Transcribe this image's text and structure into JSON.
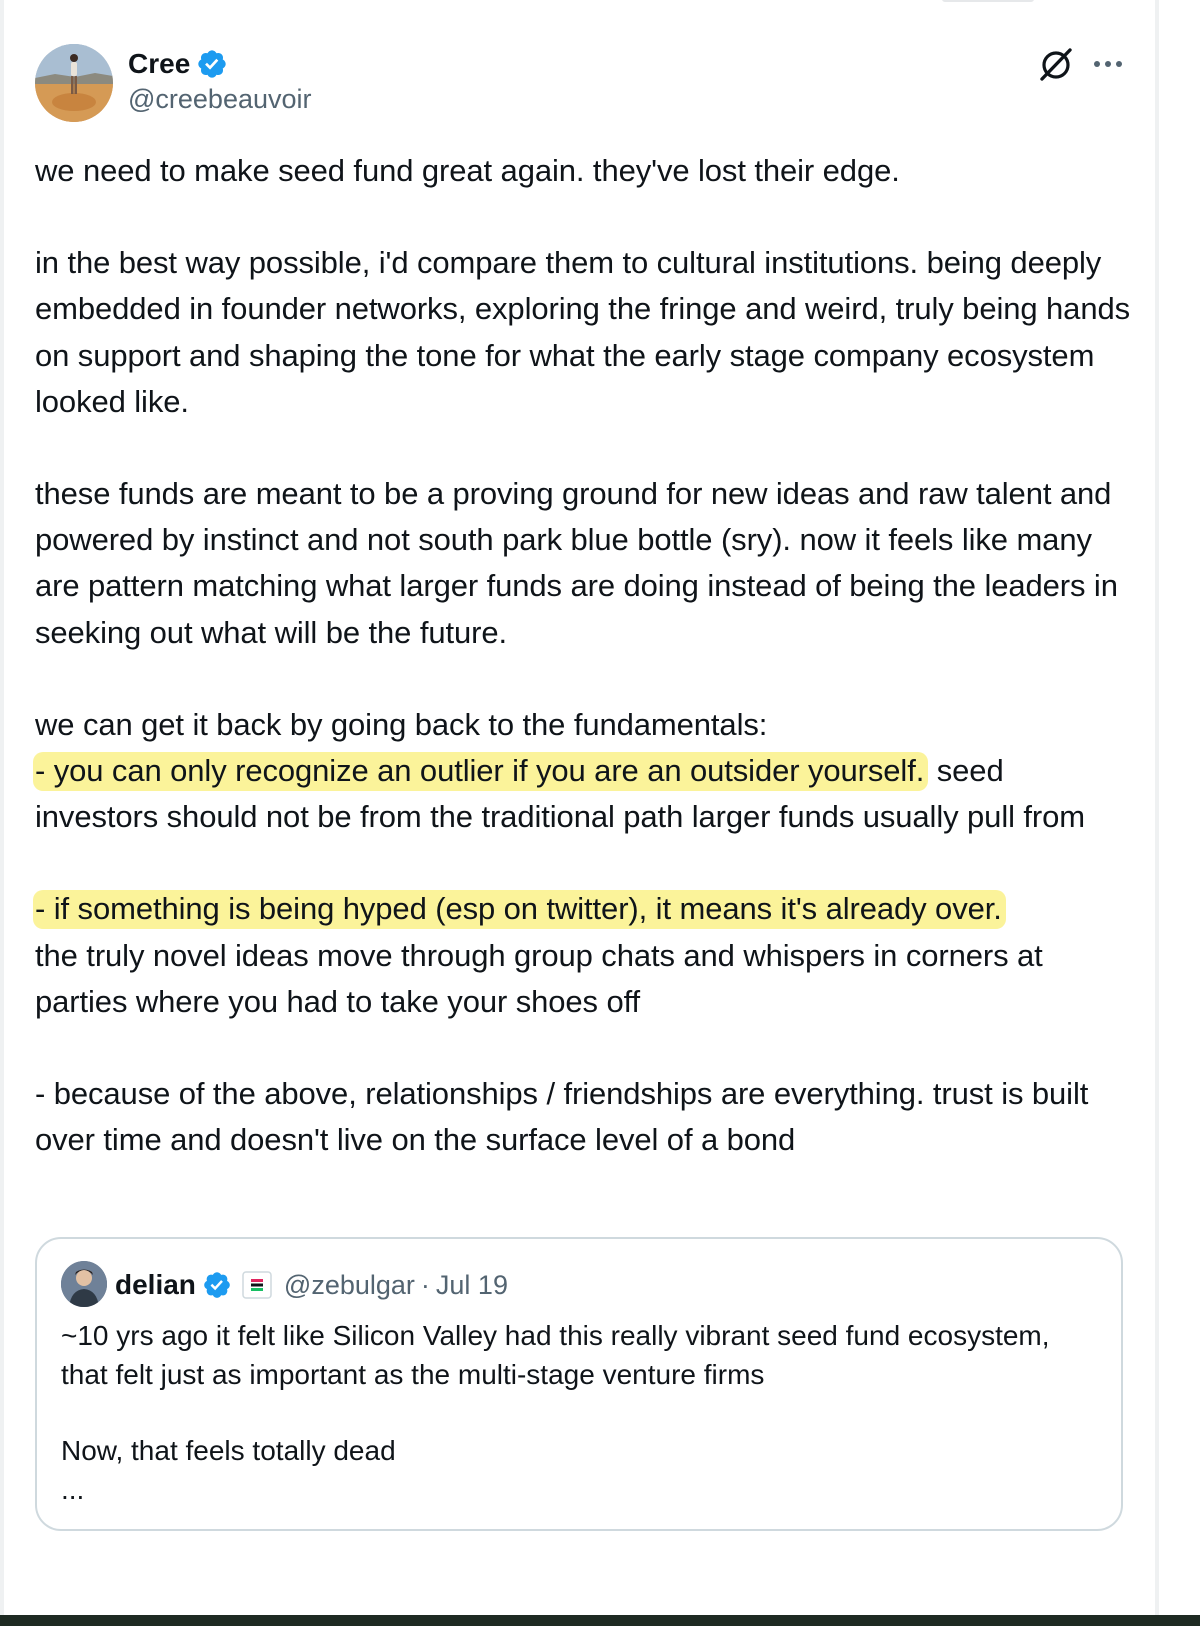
{
  "author": {
    "display_name": "Cree",
    "handle": "@creebeauvoir",
    "verified": true
  },
  "icons": {
    "verified": "verified-badge-icon",
    "grok": "grok-slash-icon",
    "more": "more-horizontal-icon",
    "flag": "flag-icon"
  },
  "colors": {
    "verified_blue": "#1d9bf0",
    "highlight": "#fbf39a",
    "secondary_text": "#536471",
    "border": "#cfd9de"
  },
  "tweet": {
    "p1": "we need to make seed fund great again. they've lost their edge.",
    "p2": "in the best way possible, i'd compare them to cultural institutions. being deeply embedded in founder networks, exploring the fringe and weird, truly being hands on support and shaping the tone for what the early stage company ecosystem looked like.",
    "p3": "these funds are meant to be a proving ground for new ideas and raw talent and powered by instinct and not south park blue bottle (sry). now it feels like many are pattern matching what larger funds are doing instead of being the leaders in seeking out what will be the future.",
    "p4_intro": "we can get it back by going back to the fundamentals:",
    "p4_highlight": "- you can only recognize an outlier if you are an outsider yourself.",
    "p4_rest": " seed investors should not be from the traditional path larger funds usually pull from",
    "p5_highlight": "- if something is being hyped (esp on twitter), it means it's already over.",
    "p5_rest": "the truly novel ideas move through group chats and whispers in corners at parties where you had to take your shoes off",
    "p6": "- because of the above, relationships / friendships are everything. trust is built over time and doesn't live on the surface level of a bond"
  },
  "quote": {
    "display_name": "delian",
    "handle": "@zebulgar",
    "separator": "·",
    "date": "Jul 19",
    "line1": "~10 yrs ago it felt like Silicon Valley had this really vibrant seed fund ecosystem, that felt just as important as the multi-stage venture firms",
    "line2": "Now, that feels totally dead",
    "ellipsis": "..."
  }
}
